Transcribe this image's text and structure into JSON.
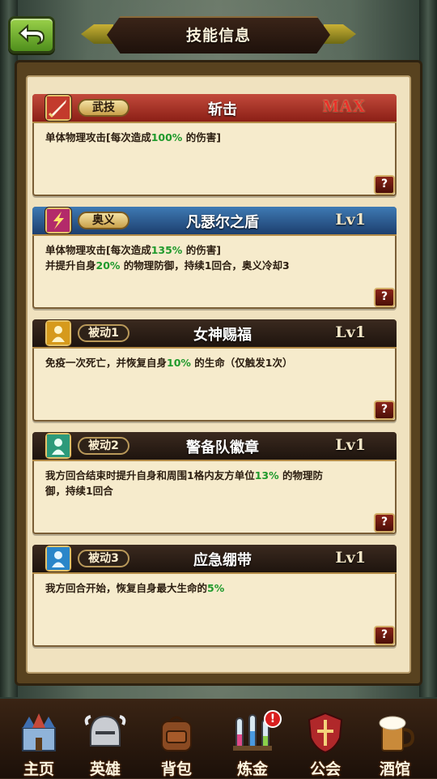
{
  "header": {
    "title": "技能信息",
    "back_icon": "back-arrow-icon"
  },
  "skills": [
    {
      "tag": "武技",
      "name": "斩击",
      "level": "MAX",
      "icon": "sword-slash-icon",
      "head_color": "#b2342a",
      "desc_lines": [
        [
          {
            "t": "单体物理攻击[每次造成"
          },
          {
            "t": "100%",
            "hl": true
          },
          {
            "t": " 的伤害]"
          }
        ]
      ]
    },
    {
      "tag": "奥义",
      "name": "凡瑟尔之盾",
      "level": "Lv1",
      "icon": "lightning-slash-icon",
      "head_color": "#2f5f94",
      "desc_lines": [
        [
          {
            "t": "单体物理攻击[每次造成"
          },
          {
            "t": "135%",
            "hl": true
          },
          {
            "t": " 的伤害]"
          }
        ],
        [
          {
            "t": "并提升自身"
          },
          {
            "t": "20%",
            "hl": true
          },
          {
            "t": " 的物理防御，持续1回合，奥义冷却3"
          }
        ]
      ]
    },
    {
      "tag": "被动1",
      "name": "女神赐福",
      "level": "Lv1",
      "icon": "golden-figure-icon",
      "head_color": "#2a1c14",
      "desc_lines": [
        [
          {
            "t": "免疫一次死亡，并恢复自身"
          },
          {
            "t": "10%",
            "hl": true
          },
          {
            "t": " 的生命（仅触发1次）"
          }
        ]
      ]
    },
    {
      "tag": "被动2",
      "name": "警备队徽章",
      "level": "Lv1",
      "icon": "green-figure-icon",
      "head_color": "#2a1c14",
      "desc_lines": [
        [
          {
            "t": "我方回合结束时提升自身和周围1格内友方单位"
          },
          {
            "t": "13%",
            "hl": true
          },
          {
            "t": " 的物理防"
          }
        ],
        [
          {
            "t": "御，持续1回合"
          }
        ]
      ]
    },
    {
      "tag": "被动3",
      "name": "应急绷带",
      "level": "Lv1",
      "icon": "blue-figure-icon",
      "head_color": "#2a1c14",
      "desc_lines": [
        [
          {
            "t": "我方回合开始，恢复自身最大生命的"
          },
          {
            "t": "5%",
            "hl": true
          }
        ]
      ]
    }
  ],
  "help_label": "?",
  "nav": [
    {
      "label": "主页",
      "icon": "castle-icon",
      "alert": false
    },
    {
      "label": "英雄",
      "icon": "knight-helmet-icon",
      "alert": false
    },
    {
      "label": "背包",
      "icon": "backpack-icon",
      "alert": false
    },
    {
      "label": "炼金",
      "icon": "potion-flasks-icon",
      "alert": true,
      "alert_text": "!"
    },
    {
      "label": "公会",
      "icon": "guild-shield-icon",
      "alert": false
    },
    {
      "label": "酒馆",
      "icon": "beer-mug-icon",
      "alert": false
    }
  ],
  "colors": {
    "highlight": "#1f9a2c",
    "max": "#e8312a",
    "parchment": "#f6ebcc"
  }
}
